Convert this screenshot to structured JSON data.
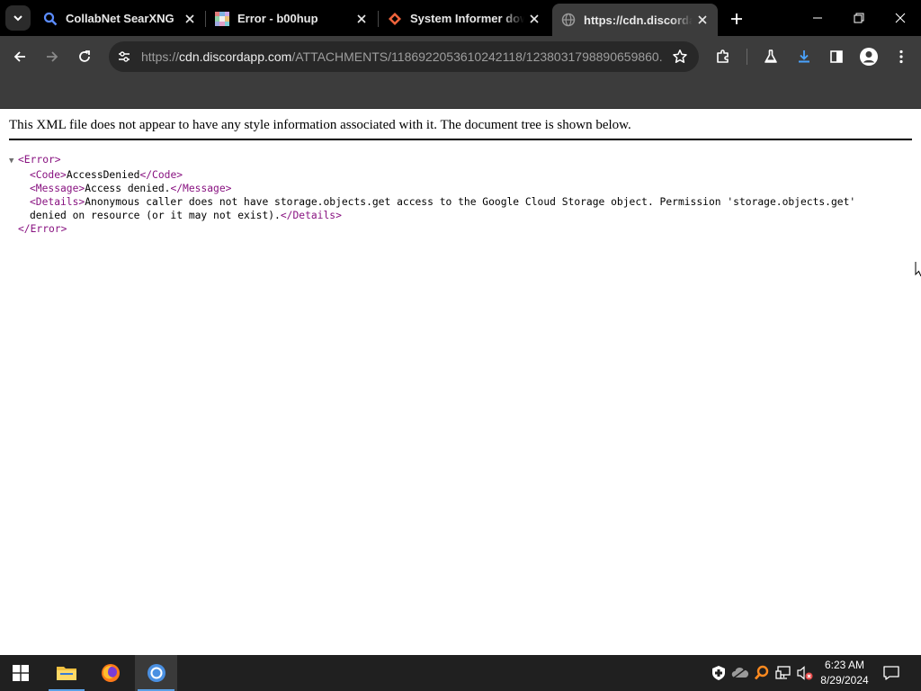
{
  "tabs": [
    {
      "title": "CollabNet SearXNG",
      "favicon": "search-favicon",
      "active": false
    },
    {
      "title": "Error - b00hup",
      "favicon": "mosaic-favicon",
      "active": false
    },
    {
      "title": "System Informer dow",
      "favicon": "diamond-favicon",
      "active": false
    },
    {
      "title": "https://cdn.discordapp",
      "favicon": "globe-favicon",
      "active": true
    }
  ],
  "address_bar": {
    "scheme": "https://",
    "host": "cdn.discordapp.com",
    "path": "/ATTACHMENTS/1186922053610242118/1238031798890659860..."
  },
  "page": {
    "xml_header": "This XML file does not appear to have any style information associated with it. The document tree is shown below.",
    "xml": {
      "root_open": "<Error>",
      "code_open": "<Code>",
      "code_value": "AccessDenied",
      "code_close": "</Code>",
      "message_open": "<Message>",
      "message_value": "Access denied.",
      "message_close": "</Message>",
      "details_open": "<Details>",
      "details_value_1": "Anonymous caller does not have storage.objects.get access to the Google Cloud Storage object. Permission 'storage.objects.get'",
      "details_value_2": "denied on resource (or it may not exist).",
      "details_close": "</Details>",
      "root_close": "</Error>"
    }
  },
  "taskbar": {
    "time": "6:23 AM",
    "date": "8/29/2024",
    "apps": [
      "windows-start",
      "file-explorer",
      "firefox",
      "chrome"
    ]
  },
  "colors": {
    "tabstrip_bg": "#000000",
    "toolbar_bg": "#3c3c3c",
    "xml_tag": "#881280",
    "taskbar_bg": "#202020",
    "download_accent": "#4aa3ff"
  }
}
